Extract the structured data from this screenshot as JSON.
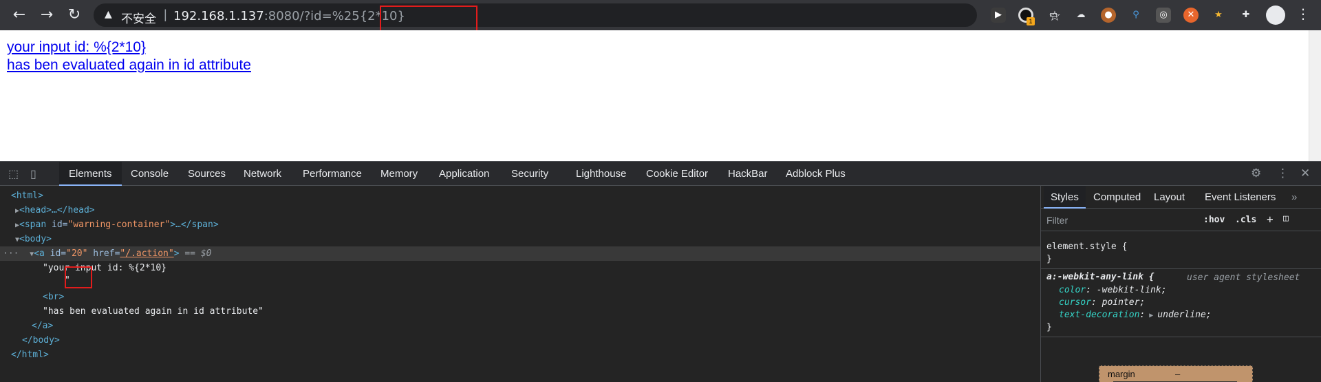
{
  "browser": {
    "back_icon": "arrow-left-icon",
    "forward_icon": "arrow-right-icon",
    "reload_icon": "reload-icon",
    "security_label": "不安全",
    "url_host": "192.168.1.137",
    "url_port": ":8080/",
    "url_query": "?id=%25{2*10}",
    "extension_badge": "1"
  },
  "page": {
    "link_line1": "your input id: %{2*10}",
    "link_line2": "has ben evaluated again in id attribute"
  },
  "devtools": {
    "tabs": [
      "Elements",
      "Console",
      "Sources",
      "Network",
      "Performance",
      "Memory",
      "Application",
      "Security",
      "Lighthouse",
      "Cookie Editor",
      "HackBar",
      "Adblock Plus"
    ],
    "active_tab": "Elements",
    "dom": {
      "html_open": "<html>",
      "head": "<head>…</head>",
      "span_tag_open": "<span ",
      "span_attr": "id=",
      "span_val": "\"warning-container\"",
      "span_close": ">…</span>",
      "body_open": "<body>",
      "a_tag_open": "<a ",
      "a_attr_id": "id=",
      "a_val_id": "\"20\"",
      "a_attr_href": " href=",
      "a_val_href": "\"/.action\"",
      "a_tag_end": ">",
      "a_eq": " == $0",
      "text1": "\"your input id: %{2*10}",
      "text1b": "\"",
      "br": "<br>",
      "text2": "\"has ben evaluated again in id attribute\"",
      "a_close": "</a>",
      "body_close": "</body>",
      "html_close": "</html>"
    },
    "sidebar": {
      "tabs": [
        "Styles",
        "Computed",
        "Layout",
        "Event Listeners"
      ],
      "filter_placeholder": "Filter",
      "hov": ":hov",
      "cls": ".cls",
      "element_style": "element.style {",
      "close_brace": "}",
      "ua_selector": "a:-webkit-any-link {",
      "ua_label": "user agent stylesheet",
      "props": [
        {
          "name": "color",
          "value": "-webkit-link;"
        },
        {
          "name": "cursor",
          "value": "pointer;"
        },
        {
          "name": "text-decoration",
          "value": "underline;"
        }
      ],
      "box_model_label": "margin",
      "box_model_value": "–"
    }
  }
}
